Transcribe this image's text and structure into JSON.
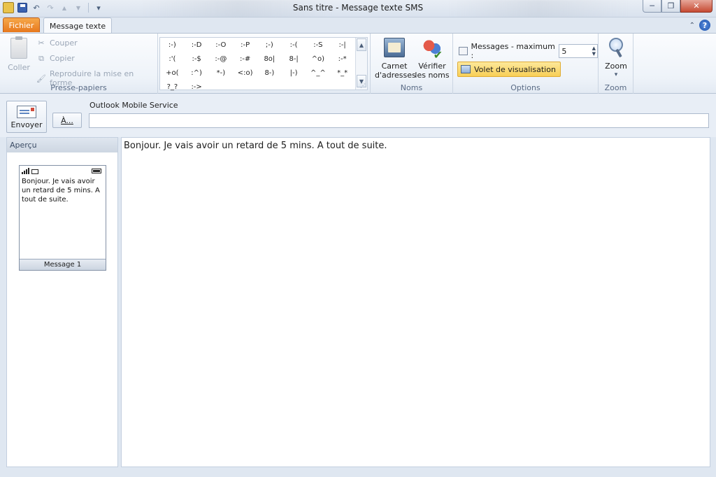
{
  "window": {
    "title": "Sans titre - Message texte SMS",
    "minimize_label": "─",
    "restore_label": "❐",
    "close_label": "✕"
  },
  "qat": {
    "undo_icon": "↶",
    "redo_icon": "↷",
    "up_icon": "▲",
    "down_icon": "▼",
    "customize_icon": "▾"
  },
  "tabs": {
    "file": "Fichier",
    "message": "Message texte",
    "collapse_icon": "⌃",
    "help_icon": "?"
  },
  "ribbon": {
    "clipboard": {
      "paste": "Coller",
      "cut": "Couper",
      "copy": "Copier",
      "format_painter": "Reproduire la mise en forme",
      "label": "Presse-papiers",
      "cut_icon": "✂",
      "copy_icon": "⧉",
      "painter_icon": "🖌"
    },
    "emoticons": [
      ":-)",
      ":-D",
      ":-O",
      ":-P",
      ";-)",
      ":-(",
      ":-S",
      ":-|",
      ":'(",
      ":-$",
      ":-@",
      ":-#",
      "8o|",
      "8-|",
      "^o)",
      ":-*",
      "+o(",
      ":^)",
      "*-)",
      "<:o)",
      "8-)",
      "|-)",
      "^_^",
      "*_*",
      "?_?",
      ":->"
    ],
    "emoticon_scroll": {
      "up": "▲",
      "down": "▼",
      "grip": "⋰"
    },
    "names": {
      "address_book_line1": "Carnet",
      "address_book_line2": "d'adresses",
      "check_names_line1": "Vérifier",
      "check_names_line2": "les noms",
      "label": "Noms"
    },
    "options": {
      "max_messages_label": "Messages - maximum :",
      "max_messages_value": "5",
      "spin_up": "▲",
      "spin_down": "▼",
      "preview_pane": "Volet de visualisation",
      "label": "Options"
    },
    "zoom": {
      "button": "Zoom",
      "arrow": "▾",
      "label": "Zoom"
    }
  },
  "compose": {
    "send": "Envoyer",
    "service": "Outlook Mobile Service",
    "to_button": "À...",
    "to_value": ""
  },
  "preview": {
    "header": "Aperçu",
    "phone_text": "Bonjour. Je vais avoir un retard de 5 mins. A tout de suite.",
    "message_label": "Message 1"
  },
  "editor": {
    "body": "Bonjour. Je vais avoir un retard de 5 mins. A tout de suite."
  }
}
